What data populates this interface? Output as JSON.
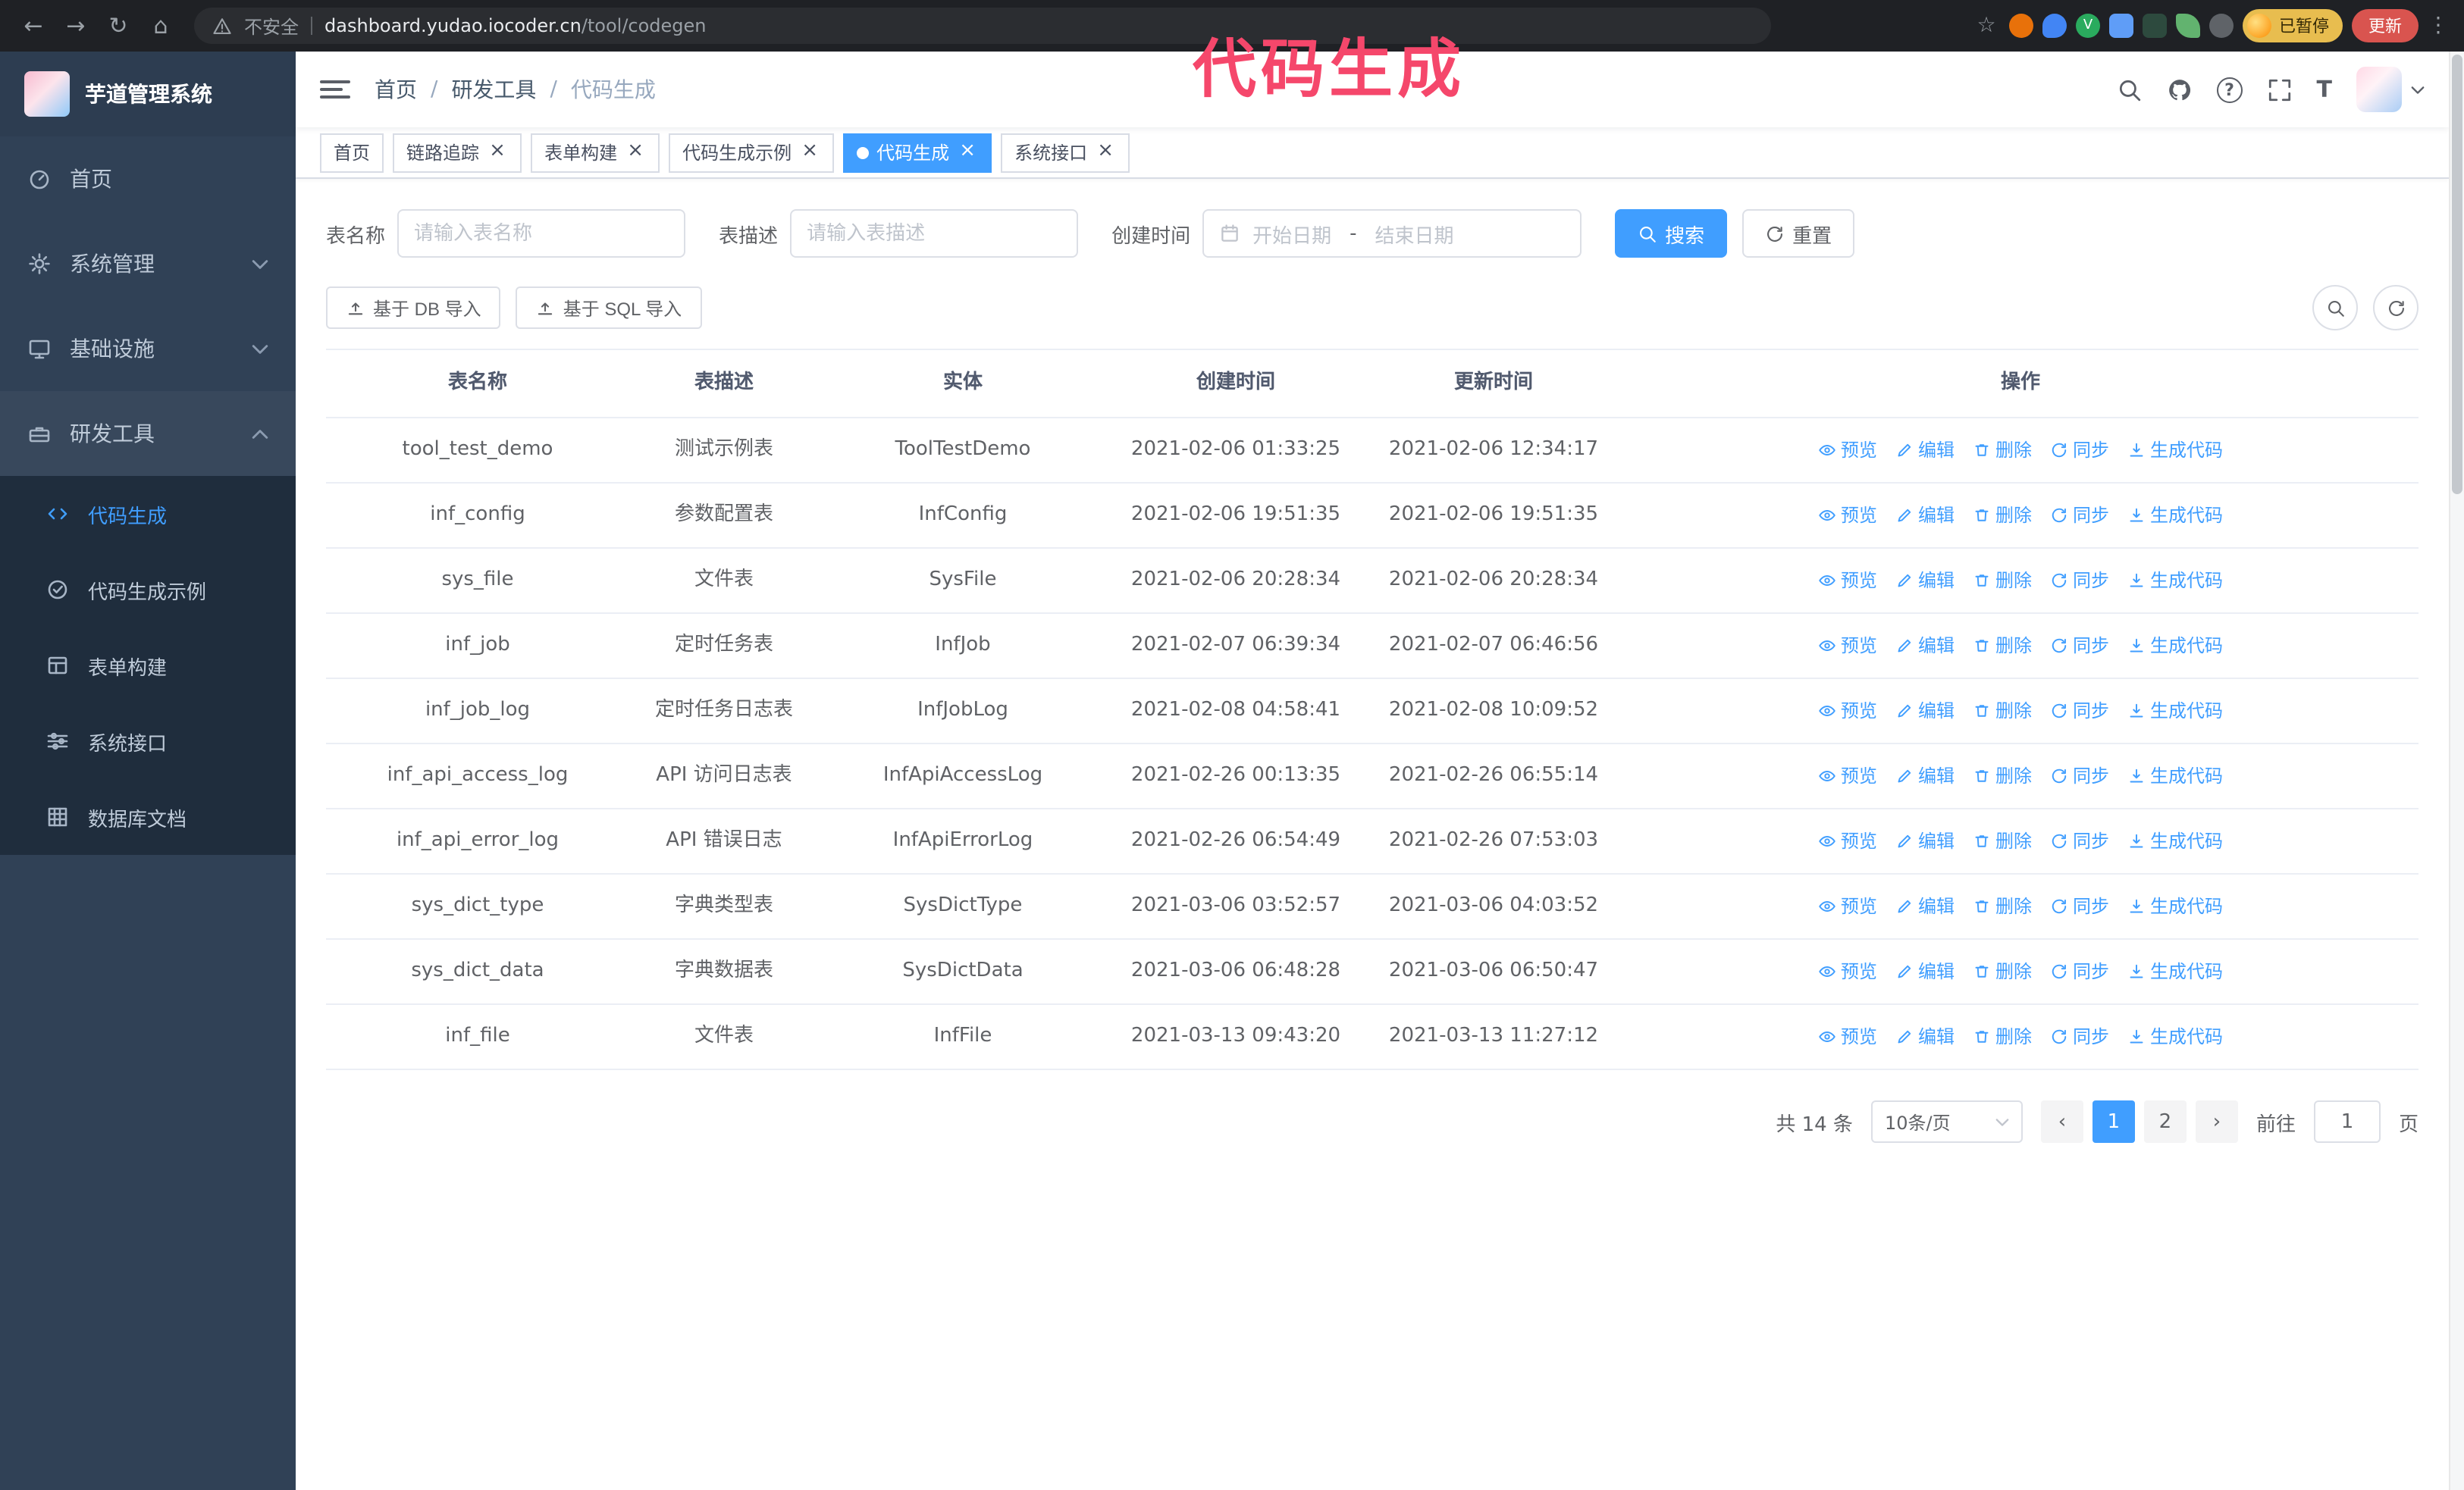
{
  "browser": {
    "security_label": "不安全",
    "url_host": "dashboard.yudao.iocoder.cn",
    "url_path": "/tool/codegen",
    "profile_chip": "已暂停",
    "update_button": "更新"
  },
  "annotation": "代码生成",
  "icons": {
    "back": "←",
    "forward": "→",
    "reload": "↻",
    "home": "⌂",
    "star": "☆",
    "more": "⋮",
    "close": "×",
    "prev": "‹",
    "next": "›",
    "sep": "/",
    "font_size": "T"
  },
  "sidebar": {
    "title": "芋道管理系统",
    "items": [
      {
        "label": "首页"
      },
      {
        "label": "系统管理"
      },
      {
        "label": "基础设施"
      },
      {
        "label": "研发工具"
      }
    ],
    "sub_items": [
      {
        "label": "代码生成"
      },
      {
        "label": "代码生成示例"
      },
      {
        "label": "表单构建"
      },
      {
        "label": "系统接口"
      },
      {
        "label": "数据库文档"
      }
    ]
  },
  "breadcrumb": {
    "items": [
      "首页",
      "研发工具",
      "代码生成"
    ]
  },
  "tabs": [
    {
      "label": "首页"
    },
    {
      "label": "链路追踪"
    },
    {
      "label": "表单构建"
    },
    {
      "label": "代码生成示例"
    },
    {
      "label": "代码生成"
    },
    {
      "label": "系统接口"
    }
  ],
  "filters": {
    "table_name_label": "表名称",
    "table_name_placeholder": "请输入表名称",
    "table_desc_label": "表描述",
    "table_desc_placeholder": "请输入表描述",
    "create_time_label": "创建时间",
    "date_start_placeholder": "开始日期",
    "date_separator": "-",
    "date_end_placeholder": "结束日期",
    "search_button": "搜索",
    "reset_button": "重置"
  },
  "toolbar": {
    "import_db_button": "基于 DB 导入",
    "import_sql_button": "基于 SQL 导入"
  },
  "table": {
    "columns": [
      "表名称",
      "表描述",
      "实体",
      "创建时间",
      "更新时间",
      "操作"
    ],
    "actions": [
      "预览",
      "编辑",
      "删除",
      "同步",
      "生成代码"
    ],
    "rows": [
      {
        "name": "tool_test_demo",
        "desc": "测试示例表",
        "entity": "ToolTestDemo",
        "create_time": "2021-02-06 01:33:25",
        "update_time": "2021-02-06 12:34:17"
      },
      {
        "name": "inf_config",
        "desc": "参数配置表",
        "entity": "InfConfig",
        "create_time": "2021-02-06 19:51:35",
        "update_time": "2021-02-06 19:51:35"
      },
      {
        "name": "sys_file",
        "desc": "文件表",
        "entity": "SysFile",
        "create_time": "2021-02-06 20:28:34",
        "update_time": "2021-02-06 20:28:34"
      },
      {
        "name": "inf_job",
        "desc": "定时任务表",
        "entity": "InfJob",
        "create_time": "2021-02-07 06:39:34",
        "update_time": "2021-02-07 06:46:56"
      },
      {
        "name": "inf_job_log",
        "desc": "定时任务日志表",
        "entity": "InfJobLog",
        "create_time": "2021-02-08 04:58:41",
        "update_time": "2021-02-08 10:09:52"
      },
      {
        "name": "inf_api_access_log",
        "desc": "API 访问日志表",
        "entity": "InfApiAccessLog",
        "create_time": "2021-02-26 00:13:35",
        "update_time": "2021-02-26 06:55:14"
      },
      {
        "name": "inf_api_error_log",
        "desc": "API 错误日志",
        "entity": "InfApiErrorLog",
        "create_time": "2021-02-26 06:54:49",
        "update_time": "2021-02-26 07:53:03"
      },
      {
        "name": "sys_dict_type",
        "desc": "字典类型表",
        "entity": "SysDictType",
        "create_time": "2021-03-06 03:52:57",
        "update_time": "2021-03-06 04:03:52"
      },
      {
        "name": "sys_dict_data",
        "desc": "字典数据表",
        "entity": "SysDictData",
        "create_time": "2021-03-06 06:48:28",
        "update_time": "2021-03-06 06:50:47"
      },
      {
        "name": "inf_file",
        "desc": "文件表",
        "entity": "InfFile",
        "create_time": "2021-03-13 09:43:20",
        "update_time": "2021-03-13 11:27:12"
      }
    ]
  },
  "pagination": {
    "total_label": "共 14 条",
    "page_size_label": "10条/页",
    "pages": [
      "1",
      "2"
    ],
    "goto_label": "前往",
    "goto_value": "1",
    "goto_unit": "页"
  },
  "colors": {
    "primary": "#409EFF",
    "sidebar_bg": "#304156",
    "submenu_bg": "#1f2d3d",
    "annotation_pink": "#f5476b",
    "update_red": "#d9544f",
    "chip_amber": "#e8bd4f"
  }
}
